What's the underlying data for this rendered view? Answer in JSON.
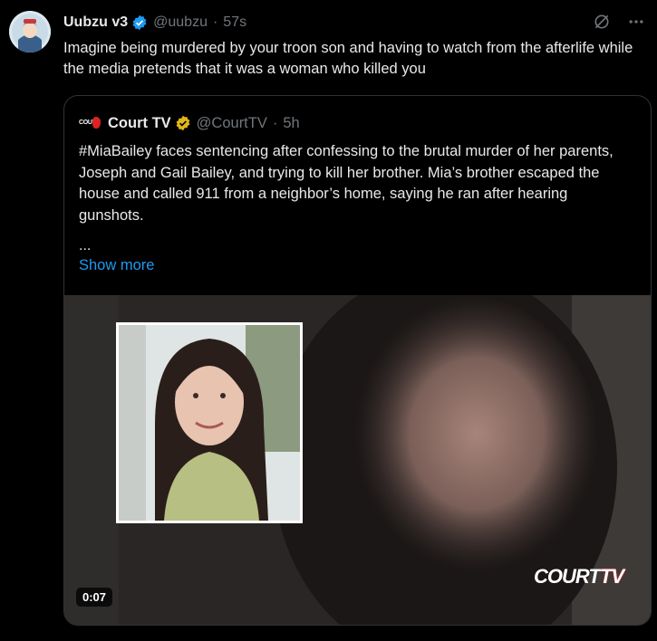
{
  "post": {
    "author_name": "Uubzu v3",
    "author_handle": "@uubzu",
    "separator": "·",
    "time": "57s",
    "text": "Imagine being murdered by your troon son and having to watch from the afterlife while the media pretends that it was a woman who killed you",
    "icons": [
      "grok-icon",
      "more-icon"
    ]
  },
  "quote": {
    "author_name": "Court TV",
    "author_handle": "@CourtTV",
    "separator": "·",
    "time": "5h",
    "logo_text": "COURT",
    "text": "#MiaBailey faces sentencing after confessing to the brutal murder of her parents, Joseph and Gail Bailey, and trying to kill her brother. Mia’s brother escaped the house and called 911 from a neighbor’s home, saying he ran after hearing gunshots.",
    "ellipsis": "...",
    "show_more": "Show more",
    "video": {
      "duration": "0:07",
      "watermark_court": "COURT",
      "watermark_tv": "TV"
    }
  },
  "colors": {
    "background": "#000000",
    "text": "#e7e9ea",
    "muted": "#71767b",
    "link": "#1d9bf0",
    "verified_blue": "#1d9bf0",
    "verified_gold": "#e2b719",
    "border": "#2f3336"
  }
}
